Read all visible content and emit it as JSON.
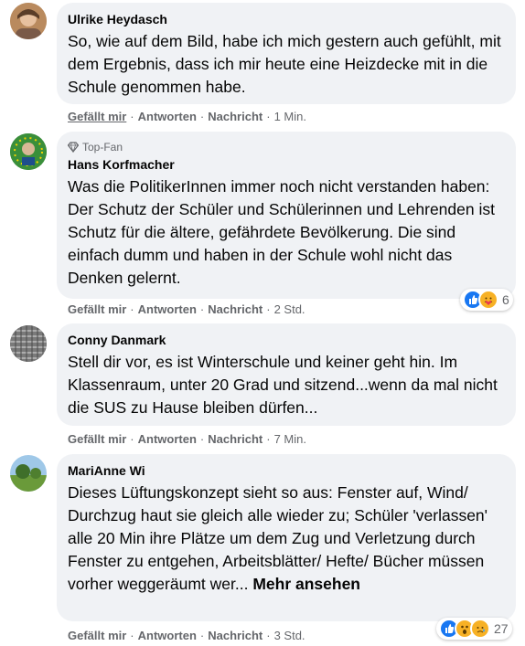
{
  "comments": [
    {
      "author": "Ulrike Heydasch",
      "badge": "",
      "text": "So, wie auf dem Bild, habe ich mich gestern auch gefühlt, mit dem Ergebnis, dass ich mir heute eine Heizdecke mit in die Schule genommen habe.",
      "more": "",
      "like": "Gefällt mir",
      "reply": "Antworten",
      "message": "Nachricht",
      "time": "1 Min.",
      "reactions_count": ""
    },
    {
      "author": "Hans Korfmacher",
      "badge": "Top-Fan",
      "text": "Was die PolitikerInnen immer noch nicht verstanden haben: Der Schutz der Schüler und Schülerinnen und Lehrenden ist Schutz für die ältere, gefährdete Bevölkerung. Die sind einfach dumm und haben in der Schule wohl nicht das Denken gelernt.",
      "more": "",
      "like": "Gefällt mir",
      "reply": "Antworten",
      "message": "Nachricht",
      "time": "2 Std.",
      "reactions_count": "6"
    },
    {
      "author": "Conny Danmark",
      "badge": "",
      "text": "Stell dir vor, es ist Winterschule und keiner geht hin. Im Klassenraum, unter 20 Grad und sitzend...wenn da mal nicht die SUS zu Hause bleiben dürfen...",
      "more": "",
      "like": "Gefällt mir",
      "reply": "Antworten",
      "message": "Nachricht",
      "time": "7 Min.",
      "reactions_count": ""
    },
    {
      "author": "MariAnne Wi",
      "badge": "",
      "text": "Dieses Lüftungskonzept sieht so aus: Fenster auf, Wind/ Durchzug haut sie gleich alle wieder zu; Schüler 'verlassen' alle 20 Min ihre Plätze um dem Zug und Verletzung durch Fenster zu entgehen, Arbeitsblätter/ Hefte/ Bücher müssen vorher weggeräumt wer...",
      "more": "Mehr ansehen",
      "like": "Gefällt mir",
      "reply": "Antworten",
      "message": "Nachricht",
      "time": "3 Std.",
      "reactions_count": "27"
    }
  ],
  "colors": {
    "bubble": "#f0f2f5",
    "meta": "#65676b",
    "like_blue": "#1877f2",
    "care_yellow": "#f7b125"
  },
  "icons": [
    "avatar",
    "diamond-icon",
    "like-reaction-icon",
    "care-reaction-icon",
    "wow-reaction-icon",
    "sad-reaction-icon"
  ]
}
